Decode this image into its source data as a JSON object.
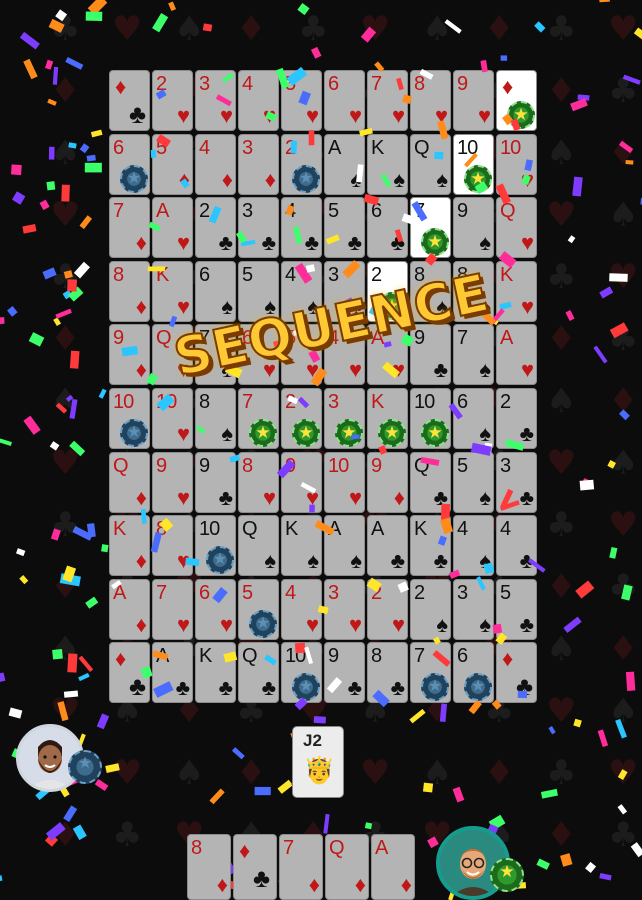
{
  "banner": "SEQUENCE",
  "colors": {
    "card_bg": "#b4b4b4",
    "highlight_bg": "#ffffff",
    "red_suit": "#c01818",
    "black_suit": "#111111",
    "blue_chip": "#3d6c8e",
    "green_chip": "#2e9a2e",
    "banner": "#ffc933"
  },
  "board": [
    [
      {
        "r": "",
        "s": "corner"
      },
      {
        "r": "2",
        "s": "♥"
      },
      {
        "r": "3",
        "s": "♥"
      },
      {
        "r": "4",
        "s": "♥"
      },
      {
        "r": "5",
        "s": "♥"
      },
      {
        "r": "6",
        "s": "♥"
      },
      {
        "r": "7",
        "s": "♥"
      },
      {
        "r": "8",
        "s": "♥"
      },
      {
        "r": "9",
        "s": "♥"
      },
      {
        "r": "",
        "s": "corner",
        "hl": true,
        "chip": "green"
      }
    ],
    [
      {
        "r": "6",
        "s": "♦",
        "chip": "blue"
      },
      {
        "r": "5",
        "s": "♦"
      },
      {
        "r": "4",
        "s": "♦"
      },
      {
        "r": "3",
        "s": "♦"
      },
      {
        "r": "2",
        "s": "♦",
        "chip": "blue"
      },
      {
        "r": "A",
        "s": "♠"
      },
      {
        "r": "K",
        "s": "♠"
      },
      {
        "r": "Q",
        "s": "♠"
      },
      {
        "r": "10",
        "s": "♠",
        "hl": true,
        "chip": "green"
      },
      {
        "r": "10",
        "s": "♥"
      }
    ],
    [
      {
        "r": "7",
        "s": "♦"
      },
      {
        "r": "A",
        "s": "♥"
      },
      {
        "r": "2",
        "s": "♣"
      },
      {
        "r": "3",
        "s": "♣"
      },
      {
        "r": "4",
        "s": "♣"
      },
      {
        "r": "5",
        "s": "♣"
      },
      {
        "r": "6",
        "s": "♣"
      },
      {
        "r": "7",
        "s": "♠",
        "hl": true,
        "chip": "green"
      },
      {
        "r": "9",
        "s": "♠"
      },
      {
        "r": "Q",
        "s": "♥"
      }
    ],
    [
      {
        "r": "8",
        "s": "♦"
      },
      {
        "r": "K",
        "s": "♥"
      },
      {
        "r": "6",
        "s": "♠"
      },
      {
        "r": "5",
        "s": "♠"
      },
      {
        "r": "4",
        "s": "♠"
      },
      {
        "r": "3",
        "s": "♠"
      },
      {
        "r": "2",
        "s": "♠",
        "hl": true,
        "chip": "green"
      },
      {
        "r": "8",
        "s": "♠"
      },
      {
        "r": "8",
        "s": "♠"
      },
      {
        "r": "K",
        "s": "♥"
      }
    ],
    [
      {
        "r": "9",
        "s": "♦"
      },
      {
        "r": "Q",
        "s": "♥"
      },
      {
        "r": "7",
        "s": "♠"
      },
      {
        "r": "6",
        "s": "♥"
      },
      {
        "r": "5",
        "s": "♥"
      },
      {
        "r": "4",
        "s": "♥"
      },
      {
        "r": "A",
        "s": "♥"
      },
      {
        "r": "9",
        "s": "♣"
      },
      {
        "r": "7",
        "s": "♠"
      },
      {
        "r": "A",
        "s": "♥"
      }
    ],
    [
      {
        "r": "10",
        "s": "♦",
        "chip": "blue"
      },
      {
        "r": "10",
        "s": "♥"
      },
      {
        "r": "8",
        "s": "♠"
      },
      {
        "r": "7",
        "s": "♥",
        "chip": "green"
      },
      {
        "r": "2",
        "s": "♥",
        "chip": "green"
      },
      {
        "r": "3",
        "s": "♥",
        "chip": "green"
      },
      {
        "r": "K",
        "s": "♦",
        "chip": "green"
      },
      {
        "r": "10",
        "s": "♣",
        "chip": "green"
      },
      {
        "r": "6",
        "s": "♠"
      },
      {
        "r": "2",
        "s": "♣"
      }
    ],
    [
      {
        "r": "Q",
        "s": "♦"
      },
      {
        "r": "9",
        "s": "♥"
      },
      {
        "r": "9",
        "s": "♣"
      },
      {
        "r": "8",
        "s": "♥"
      },
      {
        "r": "9",
        "s": "♥"
      },
      {
        "r": "10",
        "s": "♥"
      },
      {
        "r": "9",
        "s": "♦"
      },
      {
        "r": "Q",
        "s": "♣"
      },
      {
        "r": "5",
        "s": "♠"
      },
      {
        "r": "3",
        "s": "♣"
      }
    ],
    [
      {
        "r": "K",
        "s": "♦"
      },
      {
        "r": "8",
        "s": "♥"
      },
      {
        "r": "10",
        "s": "♠",
        "chip": "blue"
      },
      {
        "r": "Q",
        "s": "♠"
      },
      {
        "r": "K",
        "s": "♠"
      },
      {
        "r": "A",
        "s": "♠"
      },
      {
        "r": "A",
        "s": "♣"
      },
      {
        "r": "K",
        "s": "♣"
      },
      {
        "r": "4",
        "s": "♠"
      },
      {
        "r": "4",
        "s": "♣"
      }
    ],
    [
      {
        "r": "A",
        "s": "♦"
      },
      {
        "r": "7",
        "s": "♥"
      },
      {
        "r": "6",
        "s": "♥"
      },
      {
        "r": "5",
        "s": "♥",
        "chip": "blue"
      },
      {
        "r": "4",
        "s": "♥"
      },
      {
        "r": "3",
        "s": "♥"
      },
      {
        "r": "2",
        "s": "♥"
      },
      {
        "r": "2",
        "s": "♠"
      },
      {
        "r": "3",
        "s": "♠"
      },
      {
        "r": "5",
        "s": "♣"
      }
    ],
    [
      {
        "r": "",
        "s": "corner"
      },
      {
        "r": "A",
        "s": "♣"
      },
      {
        "r": "K",
        "s": "♣"
      },
      {
        "r": "Q",
        "s": "♣"
      },
      {
        "r": "10",
        "s": "♣",
        "chip": "blue"
      },
      {
        "r": "9",
        "s": "♣"
      },
      {
        "r": "8",
        "s": "♣"
      },
      {
        "r": "7",
        "s": "♣",
        "chip": "blue"
      },
      {
        "r": "6",
        "s": "♣",
        "chip": "blue"
      },
      {
        "r": "",
        "s": "corner"
      }
    ]
  ],
  "discard": {
    "rank": "J2"
  },
  "hand": [
    {
      "r": "8",
      "s": "♦"
    },
    {
      "r": "",
      "s": "corner"
    },
    {
      "r": "7",
      "s": "♦"
    },
    {
      "r": "Q",
      "s": "♦"
    },
    {
      "r": "A",
      "s": "♦"
    }
  ],
  "players": {
    "left": {
      "avatar_icon": "avatar-bearded-man-icon",
      "chip": "blue"
    },
    "right": {
      "avatar_icon": "avatar-glasses-man-icon",
      "chip": "green"
    }
  }
}
